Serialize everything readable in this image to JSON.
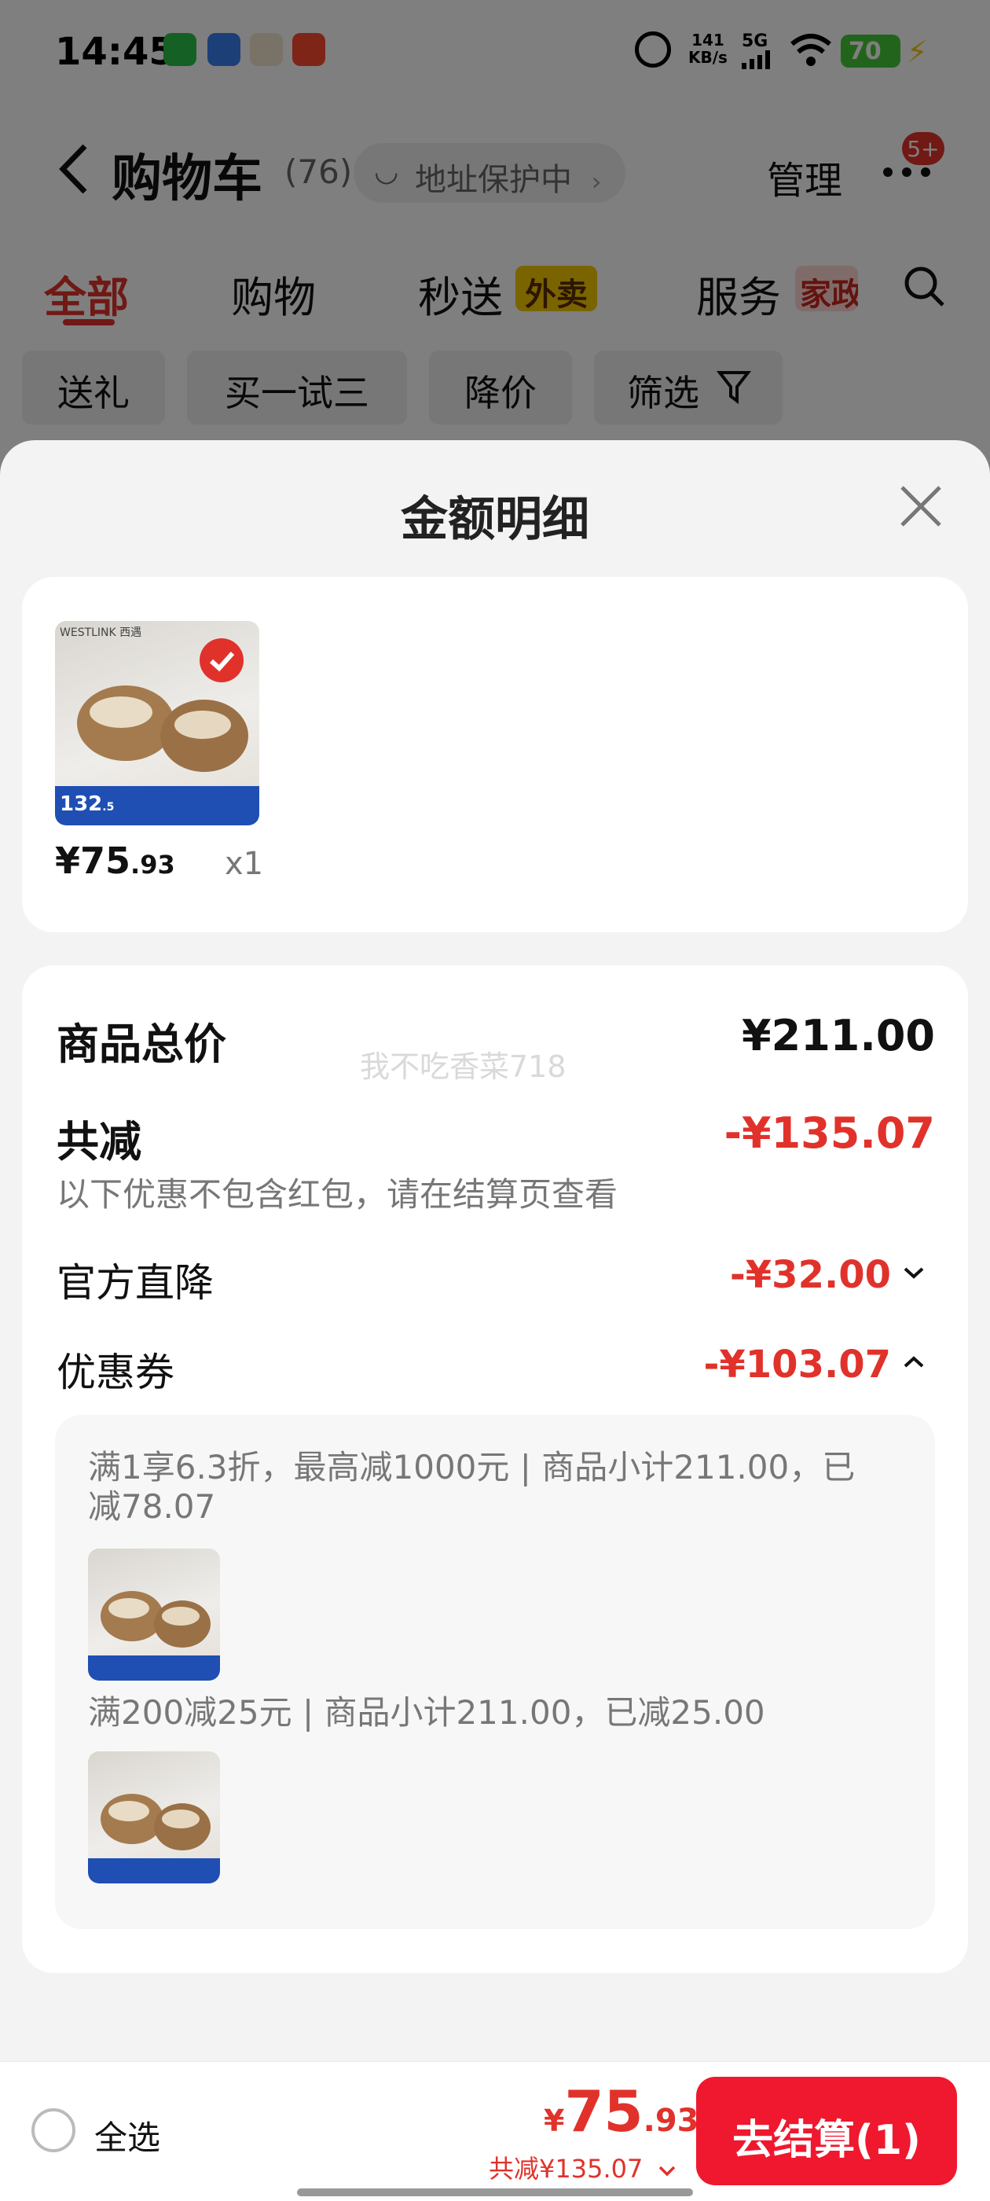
{
  "status_bar": {
    "time": "14:45",
    "net_speed": "141\nKB/s",
    "network": "5G",
    "battery": "70"
  },
  "header": {
    "title": "购物车",
    "count": "(76)",
    "address_protect": "地址保护中",
    "manage": "管理",
    "badge": "5+"
  },
  "tabs": [
    {
      "label": "全部"
    },
    {
      "label": "购物"
    },
    {
      "label": "秒送",
      "tag": "外卖"
    },
    {
      "label": "服务",
      "tag": "家政"
    }
  ],
  "chips": [
    "送礼",
    "买一试三",
    "降价",
    "筛选"
  ],
  "sheet": {
    "title": "金额明细",
    "product": {
      "brand": "WESTLINK 西遇",
      "price_big": "¥75",
      "price_small": ".93",
      "quantity": "x1",
      "thumb_price": "132",
      "thumb_price_small": ".5"
    },
    "summary": {
      "total_label": "商品总价",
      "total_value": "¥211.00",
      "discount_label": "共减",
      "discount_value": "-¥135.07",
      "discount_note": "以下优惠不包含红包，请在结算页查看",
      "official_label": "官方直降",
      "official_value": "-¥32.00",
      "coupon_label": "优惠券",
      "coupon_value": "-¥103.07",
      "watermark": "我不吃香菜718"
    },
    "coupon_details": [
      {
        "desc": "满1享6.3折，最高减1000元 | 商品小计211.00，已减78.07"
      },
      {
        "desc": "满200减25元 | 商品小计211.00，已减25.00"
      }
    ]
  },
  "footer": {
    "select_all": "全选",
    "currency": "¥",
    "price_big": "75",
    "price_small": ".93",
    "total_discount": "共减¥135.07",
    "checkout": "去结算(1)"
  },
  "colors": {
    "brand_red": "#e0322b",
    "checkout_red": "#f0182e",
    "tag_yellow": "#f5c800"
  }
}
